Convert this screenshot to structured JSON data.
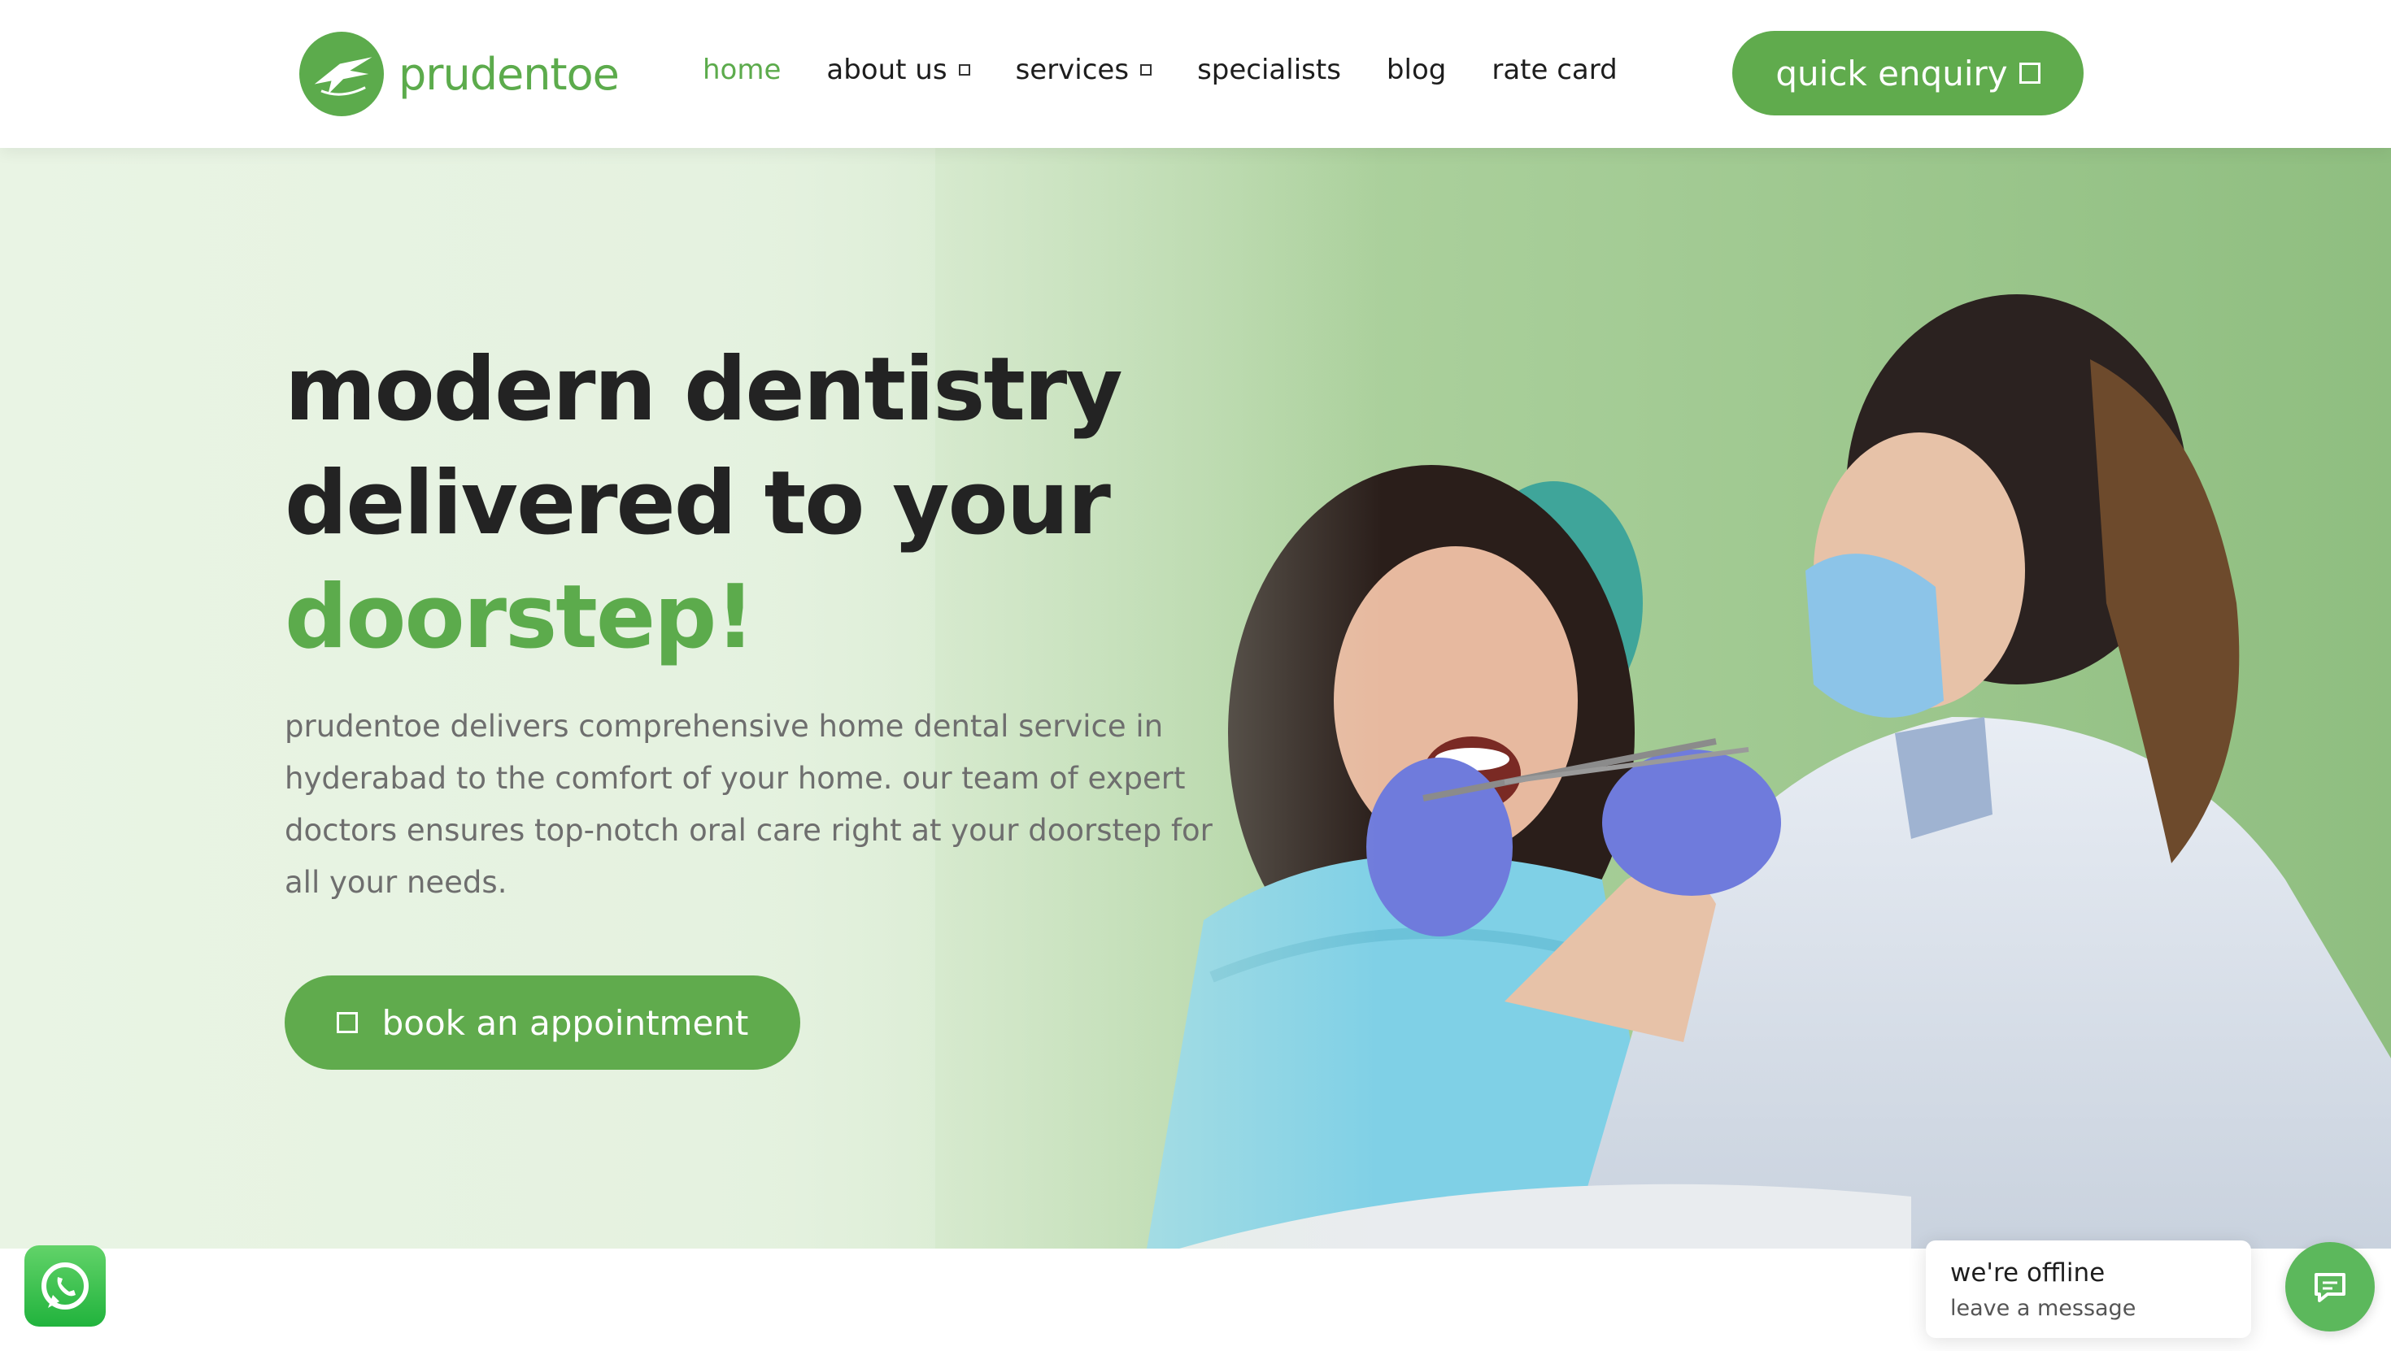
{
  "brand": {
    "name": "prudentoe",
    "accent_color": "#5cab4c",
    "logo_icon": "plane-circle-logo-icon"
  },
  "nav": {
    "items": [
      {
        "label": "home",
        "active": true,
        "has_dropdown": false
      },
      {
        "label": "about us",
        "active": false,
        "has_dropdown": true
      },
      {
        "label": "services",
        "active": false,
        "has_dropdown": true
      },
      {
        "label": "specialists",
        "active": false,
        "has_dropdown": false
      },
      {
        "label": "blog",
        "active": false,
        "has_dropdown": false
      },
      {
        "label": "rate card",
        "active": false,
        "has_dropdown": false
      }
    ],
    "cta_label": "quick enquiry"
  },
  "hero": {
    "headline_line1": "modern dentistry",
    "headline_line2": "delivered to your",
    "headline_accent": "doorstep!",
    "description": "prudentoe delivers comprehensive home dental service in hyderabad to the comfort of your home. our team of expert doctors ensures top-notch oral care right at your doorstep for all your needs.",
    "button_label": "book an appointment",
    "image_subject": "dentist-examining-patient-photo"
  },
  "widgets": {
    "whatsapp_icon": "whatsapp-icon",
    "chat_title": "we're offline",
    "chat_subtitle": "leave a message",
    "chat_icon": "chat-bubble-icon"
  }
}
